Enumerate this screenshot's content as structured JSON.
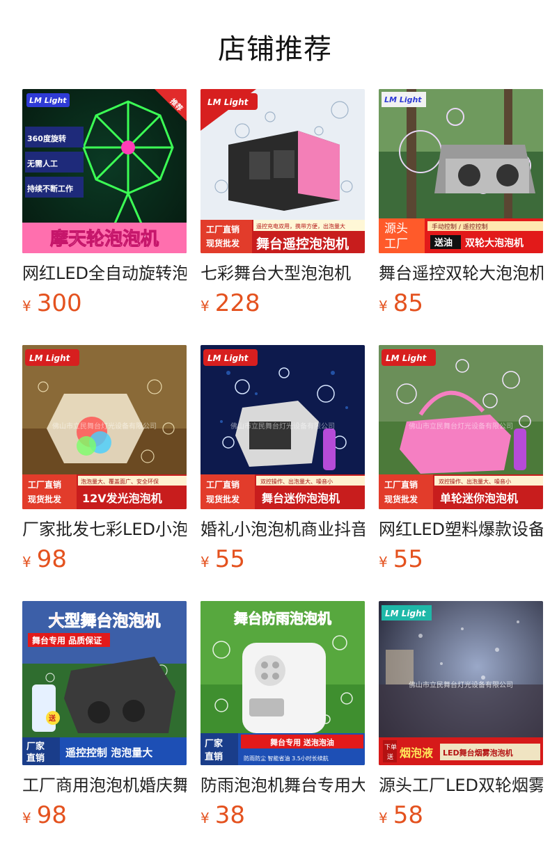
{
  "page": {
    "title": "店铺推荐"
  },
  "currency_symbol": "¥",
  "products": [
    {
      "name": "网红LED全自动旋转泡泡机",
      "price": "300",
      "image": {
        "logo": "LM Light",
        "corner_tag": "推荐",
        "features": [
          "360度旋转",
          "无需人工",
          "持续不断工作"
        ],
        "caption": "摩天轮泡泡机"
      }
    },
    {
      "name": "七彩舞台大型泡泡机",
      "price": "228",
      "image": {
        "logo": "LM Light",
        "badge_top": "工厂直销",
        "badge_bottom": "现货批发",
        "subtitle": "遥控充电双用，携带方便，出泡量大",
        "caption": "舞台遥控泡泡机"
      }
    },
    {
      "name": "舞台遥控双轮大泡泡机",
      "price": "85",
      "image": {
        "logo": "LM Light",
        "badge_top": "源头",
        "badge_bottom": "工厂",
        "subtitle": "手动控制 / 遥控控制",
        "gift": "送油",
        "caption": "双轮大泡泡机"
      }
    },
    {
      "name": "厂家批发七彩LED小泡泡机",
      "price": "98",
      "image": {
        "logo": "LM Light",
        "watermark": "佛山市立民舞台灯光设备有限公司",
        "badge_top": "工厂直销",
        "badge_bottom": "现货批发",
        "subtitle": "泡泡量大、覆盖面广、安全环保",
        "caption": "12V发光泡泡机"
      }
    },
    {
      "name": "婚礼小泡泡机商业抖音",
      "price": "55",
      "image": {
        "logo": "LM Light",
        "watermark": "佛山市立民舞台灯光设备有限公司",
        "badge_top": "工厂直销",
        "badge_bottom": "现货批发",
        "subtitle": "双控操作、出泡量大、噪音小",
        "caption": "舞台迷你泡泡机"
      }
    },
    {
      "name": "网红LED塑料爆款设备",
      "price": "55",
      "image": {
        "logo": "LM Light",
        "watermark": "佛山市立民舞台灯光设备有限公司",
        "badge_top": "工厂直销",
        "badge_bottom": "现货批发",
        "subtitle": "双控操作、出泡量大、噪音小",
        "caption": "单轮迷你泡泡机"
      }
    },
    {
      "name": "工厂商用泡泡机婚庆舞台",
      "price": "98",
      "image": {
        "headline": "大型舞台泡泡机",
        "tagline": "舞台专用 品质保证",
        "gift": "送",
        "badge_top": "厂家",
        "badge_bottom": "直销",
        "caption": "遥控控制 泡泡量大"
      }
    },
    {
      "name": "防雨泡泡机舞台专用大型",
      "price": "38",
      "image": {
        "headline": "舞台防雨泡泡机",
        "badge_top": "厂家",
        "badge_bottom": "直销",
        "subtitle": "舞台专用 送泡泡油",
        "caption": "防雨防尘 智能省油 3.5小时长续航"
      }
    },
    {
      "name": "源头工厂LED双轮烟雾泡泡机",
      "price": "58",
      "image": {
        "logo": "LM Light",
        "watermark": "佛山市立民舞台灯光设备有限公司",
        "badge_top": "下单",
        "badge_bottom": "送",
        "gift": "烟泡液",
        "caption": "LED舞台烟雾泡泡机"
      }
    }
  ]
}
